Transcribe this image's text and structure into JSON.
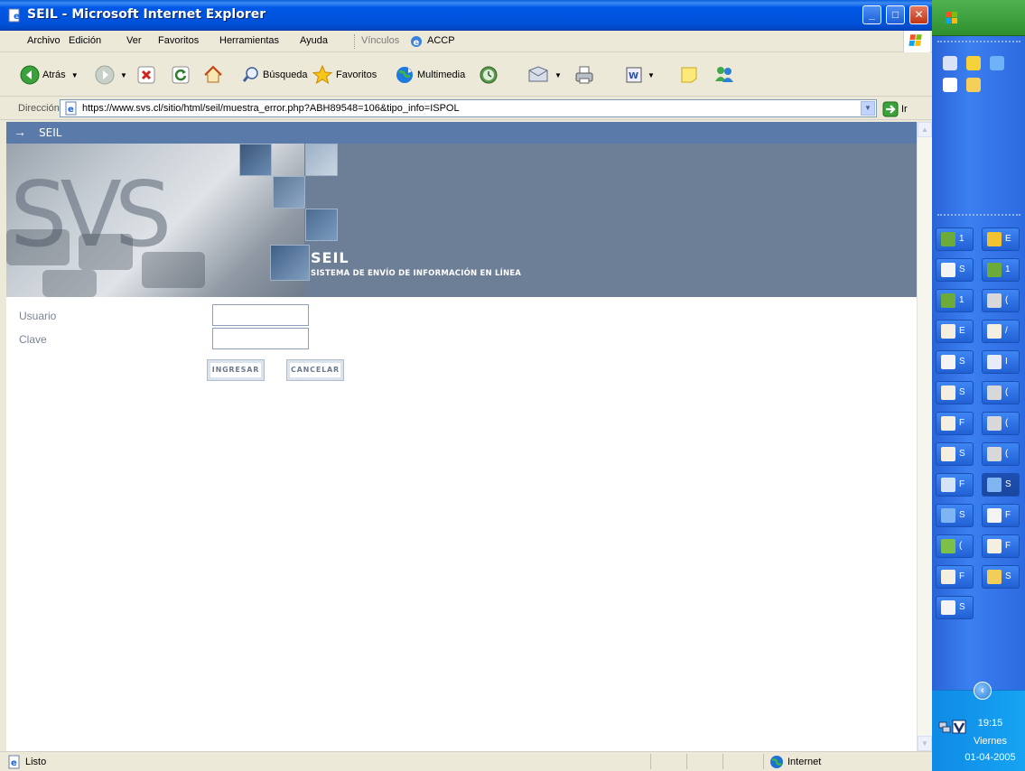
{
  "window": {
    "title": "SEIL - Microsoft Internet Explorer",
    "controls": {
      "minimize": "_",
      "maximize": "□",
      "close": "✕"
    }
  },
  "menu": {
    "items": [
      "Archivo",
      "Edición",
      "Ver",
      "Favoritos",
      "Herramientas",
      "Ayuda"
    ],
    "links_label": "Vínculos",
    "links_item": "ACCP"
  },
  "toolbar": {
    "back_label": "Atrás",
    "search_label": "Búsqueda",
    "favorites_label": "Favoritos",
    "media_label": "Multimedia"
  },
  "address": {
    "label": "Dirección",
    "url": "https://www.svs.cl/sitio/html/seil/muestra_error.php?ABH89548=106&tipo_info=ISPOL",
    "go_label": "Ir"
  },
  "page": {
    "strip_label": "SEIL",
    "banner_letters": "SVS",
    "banner_title": "SEIL",
    "banner_subtitle": "SISTEMA DE ENVÍO DE INFORMACIÓN EN LÍNEA",
    "form": {
      "usuario_label": "Usuario",
      "clave_label": "Clave",
      "usuario_value": "",
      "clave_value": "",
      "submit_label": "INGRESAR",
      "cancel_label": "CANCELAR"
    }
  },
  "status": {
    "text": "Listo",
    "zone": "Internet"
  },
  "taskbar": {
    "buttons": [
      {
        "label": "1",
        "icon": "users-icon"
      },
      {
        "label": "E",
        "icon": "outlook-icon"
      },
      {
        "label": "S",
        "icon": "document-icon"
      },
      {
        "label": "1",
        "icon": "users-icon"
      },
      {
        "label": "1",
        "icon": "users-icon"
      },
      {
        "label": "(",
        "icon": "powerpoint-icon"
      },
      {
        "label": "E",
        "icon": "mail-icon"
      },
      {
        "label": "/",
        "icon": "mail-icon"
      },
      {
        "label": "S",
        "icon": "document-icon"
      },
      {
        "label": "I",
        "icon": "word-icon"
      },
      {
        "label": "S",
        "icon": "mail-icon"
      },
      {
        "label": "(",
        "icon": "powerpoint-icon"
      },
      {
        "label": "F",
        "icon": "mail-icon"
      },
      {
        "label": "(",
        "icon": "powerpoint-icon"
      },
      {
        "label": "S",
        "icon": "mail-icon"
      },
      {
        "label": "(",
        "icon": "powerpoint-icon"
      },
      {
        "label": "F",
        "icon": "file-icon"
      },
      {
        "label": "S",
        "icon": "ie-icon"
      },
      {
        "label": "S",
        "icon": "ie-icon"
      },
      {
        "label": "F",
        "icon": "document-icon"
      },
      {
        "label": "(",
        "icon": "download-icon"
      },
      {
        "label": "F",
        "icon": "mail-icon"
      },
      {
        "label": "F",
        "icon": "mail-icon"
      },
      {
        "label": "S",
        "icon": "folder-icon"
      },
      {
        "label": "S",
        "icon": "document-icon"
      }
    ],
    "clock": {
      "time": "19:15",
      "day": "Viernes",
      "date": "01-04-2005"
    }
  },
  "colors": {
    "title_bar": "#0058e6",
    "seil_strip": "#5a7aa9",
    "banner": "#6d7f97",
    "taskbar": "#2d6ae0",
    "start": "#3a9b3a"
  }
}
